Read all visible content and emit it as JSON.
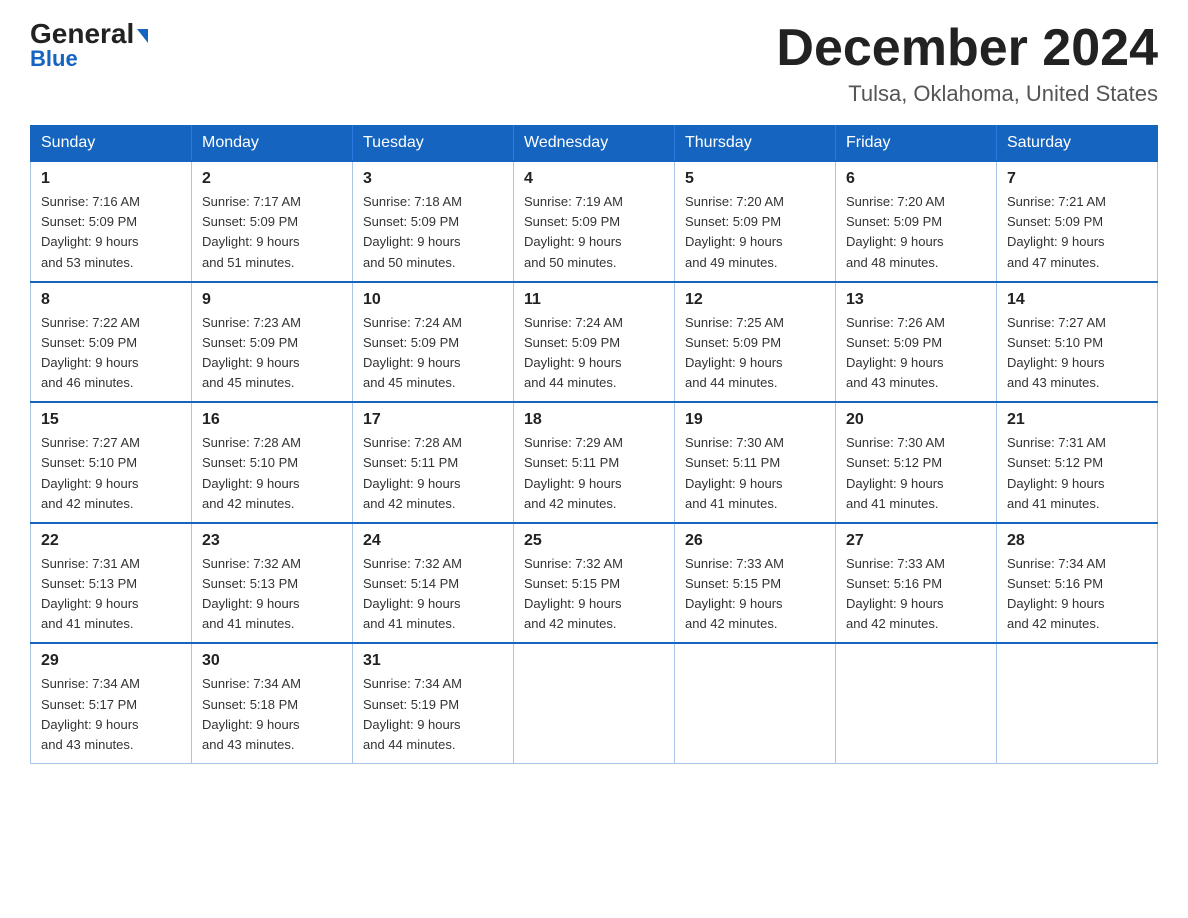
{
  "header": {
    "logo_line1": "General",
    "logo_line2": "Blue",
    "month_title": "December 2024",
    "location": "Tulsa, Oklahoma, United States"
  },
  "days_of_week": [
    "Sunday",
    "Monday",
    "Tuesday",
    "Wednesday",
    "Thursday",
    "Friday",
    "Saturday"
  ],
  "weeks": [
    [
      {
        "day": "1",
        "sunrise": "7:16 AM",
        "sunset": "5:09 PM",
        "daylight": "9 hours and 53 minutes."
      },
      {
        "day": "2",
        "sunrise": "7:17 AM",
        "sunset": "5:09 PM",
        "daylight": "9 hours and 51 minutes."
      },
      {
        "day": "3",
        "sunrise": "7:18 AM",
        "sunset": "5:09 PM",
        "daylight": "9 hours and 50 minutes."
      },
      {
        "day": "4",
        "sunrise": "7:19 AM",
        "sunset": "5:09 PM",
        "daylight": "9 hours and 50 minutes."
      },
      {
        "day": "5",
        "sunrise": "7:20 AM",
        "sunset": "5:09 PM",
        "daylight": "9 hours and 49 minutes."
      },
      {
        "day": "6",
        "sunrise": "7:20 AM",
        "sunset": "5:09 PM",
        "daylight": "9 hours and 48 minutes."
      },
      {
        "day": "7",
        "sunrise": "7:21 AM",
        "sunset": "5:09 PM",
        "daylight": "9 hours and 47 minutes."
      }
    ],
    [
      {
        "day": "8",
        "sunrise": "7:22 AM",
        "sunset": "5:09 PM",
        "daylight": "9 hours and 46 minutes."
      },
      {
        "day": "9",
        "sunrise": "7:23 AM",
        "sunset": "5:09 PM",
        "daylight": "9 hours and 45 minutes."
      },
      {
        "day": "10",
        "sunrise": "7:24 AM",
        "sunset": "5:09 PM",
        "daylight": "9 hours and 45 minutes."
      },
      {
        "day": "11",
        "sunrise": "7:24 AM",
        "sunset": "5:09 PM",
        "daylight": "9 hours and 44 minutes."
      },
      {
        "day": "12",
        "sunrise": "7:25 AM",
        "sunset": "5:09 PM",
        "daylight": "9 hours and 44 minutes."
      },
      {
        "day": "13",
        "sunrise": "7:26 AM",
        "sunset": "5:09 PM",
        "daylight": "9 hours and 43 minutes."
      },
      {
        "day": "14",
        "sunrise": "7:27 AM",
        "sunset": "5:10 PM",
        "daylight": "9 hours and 43 minutes."
      }
    ],
    [
      {
        "day": "15",
        "sunrise": "7:27 AM",
        "sunset": "5:10 PM",
        "daylight": "9 hours and 42 minutes."
      },
      {
        "day": "16",
        "sunrise": "7:28 AM",
        "sunset": "5:10 PM",
        "daylight": "9 hours and 42 minutes."
      },
      {
        "day": "17",
        "sunrise": "7:28 AM",
        "sunset": "5:11 PM",
        "daylight": "9 hours and 42 minutes."
      },
      {
        "day": "18",
        "sunrise": "7:29 AM",
        "sunset": "5:11 PM",
        "daylight": "9 hours and 42 minutes."
      },
      {
        "day": "19",
        "sunrise": "7:30 AM",
        "sunset": "5:11 PM",
        "daylight": "9 hours and 41 minutes."
      },
      {
        "day": "20",
        "sunrise": "7:30 AM",
        "sunset": "5:12 PM",
        "daylight": "9 hours and 41 minutes."
      },
      {
        "day": "21",
        "sunrise": "7:31 AM",
        "sunset": "5:12 PM",
        "daylight": "9 hours and 41 minutes."
      }
    ],
    [
      {
        "day": "22",
        "sunrise": "7:31 AM",
        "sunset": "5:13 PM",
        "daylight": "9 hours and 41 minutes."
      },
      {
        "day": "23",
        "sunrise": "7:32 AM",
        "sunset": "5:13 PM",
        "daylight": "9 hours and 41 minutes."
      },
      {
        "day": "24",
        "sunrise": "7:32 AM",
        "sunset": "5:14 PM",
        "daylight": "9 hours and 41 minutes."
      },
      {
        "day": "25",
        "sunrise": "7:32 AM",
        "sunset": "5:15 PM",
        "daylight": "9 hours and 42 minutes."
      },
      {
        "day": "26",
        "sunrise": "7:33 AM",
        "sunset": "5:15 PM",
        "daylight": "9 hours and 42 minutes."
      },
      {
        "day": "27",
        "sunrise": "7:33 AM",
        "sunset": "5:16 PM",
        "daylight": "9 hours and 42 minutes."
      },
      {
        "day": "28",
        "sunrise": "7:34 AM",
        "sunset": "5:16 PM",
        "daylight": "9 hours and 42 minutes."
      }
    ],
    [
      {
        "day": "29",
        "sunrise": "7:34 AM",
        "sunset": "5:17 PM",
        "daylight": "9 hours and 43 minutes."
      },
      {
        "day": "30",
        "sunrise": "7:34 AM",
        "sunset": "5:18 PM",
        "daylight": "9 hours and 43 minutes."
      },
      {
        "day": "31",
        "sunrise": "7:34 AM",
        "sunset": "5:19 PM",
        "daylight": "9 hours and 44 minutes."
      },
      null,
      null,
      null,
      null
    ]
  ],
  "labels": {
    "sunrise_prefix": "Sunrise: ",
    "sunset_prefix": "Sunset: ",
    "daylight_prefix": "Daylight: "
  }
}
